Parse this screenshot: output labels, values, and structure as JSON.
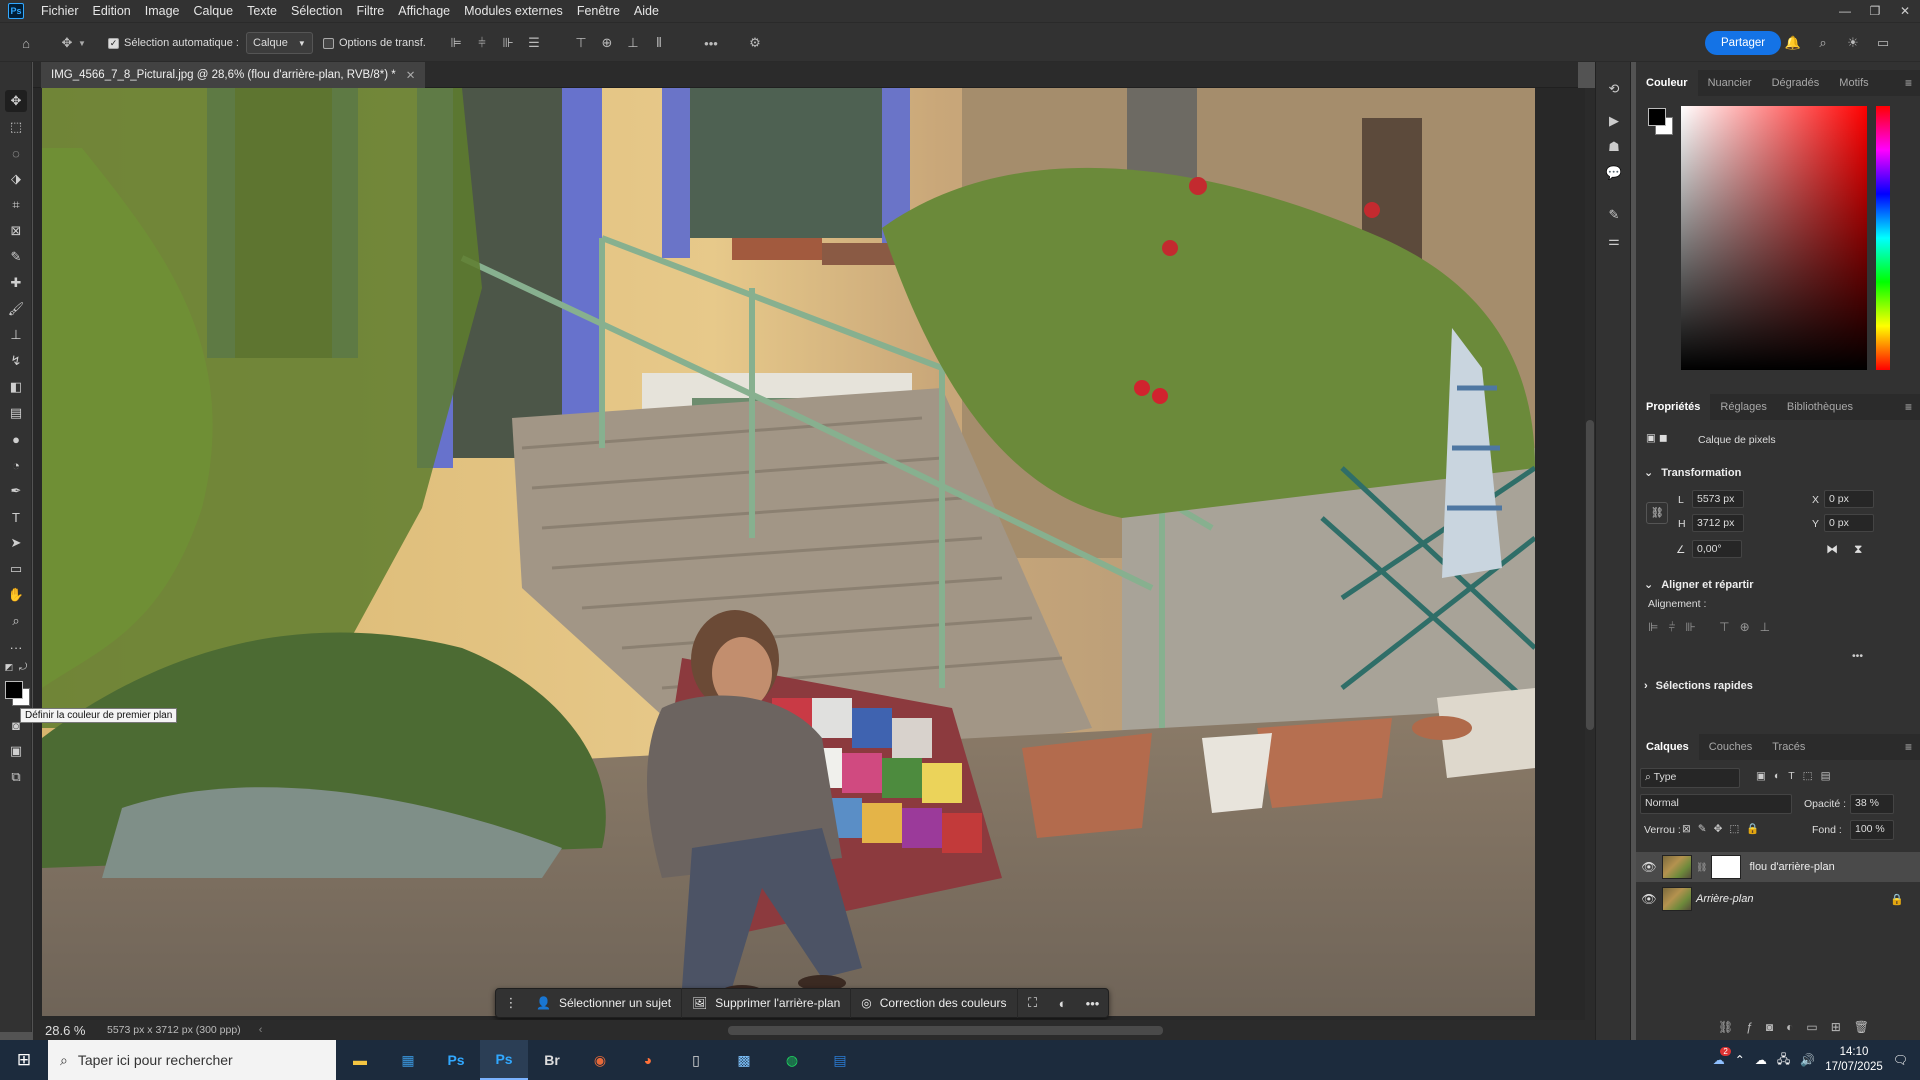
{
  "menubar": {
    "logo": "Ps",
    "items": [
      "Fichier",
      "Edition",
      "Image",
      "Calque",
      "Texte",
      "Sélection",
      "Filtre",
      "Affichage",
      "Modules externes",
      "Fenêtre",
      "Aide"
    ]
  },
  "options": {
    "auto_select_label": "Sélection automatique :",
    "auto_select_checked": true,
    "layer_dropdown": "Calque",
    "transform_label": "Options de transf.",
    "share_label": "Partager"
  },
  "document": {
    "tab_title": "IMG_4566_7_8_Pictural.jpg @ 28,6% (flou d'arrière-plan, RVB/8*) *",
    "zoom": "28.6 %",
    "info": "5573 px x 3712 px (300 ppp)"
  },
  "tooltip": "Définir la couleur de premier plan",
  "context_bar": {
    "select_subject": "Sélectionner un sujet",
    "remove_bg": "Supprimer l'arrière-plan",
    "color_correction": "Correction des couleurs"
  },
  "color_panel": {
    "tabs": [
      "Couleur",
      "Nuancier",
      "Dégradés",
      "Motifs"
    ],
    "foreground": "#000000",
    "background": "#ffffff"
  },
  "properties_panel": {
    "tabs": [
      "Propriétés",
      "Réglages",
      "Bibliothèques"
    ],
    "layer_type": "Calque de pixels",
    "transformation_title": "Transformation",
    "w_label": "L",
    "w_value": "5573 px",
    "h_label": "H",
    "h_value": "3712 px",
    "x_label": "X",
    "x_value": "0 px",
    "y_label": "Y",
    "y_value": "0 px",
    "angle_value": "0,00°",
    "align_title": "Aligner et répartir",
    "alignment_label": "Alignement :",
    "quick_actions_title": "Sélections rapides"
  },
  "layers_panel": {
    "tabs": [
      "Calques",
      "Couches",
      "Tracés"
    ],
    "filter_label": "Type",
    "blend_mode": "Normal",
    "opacity_label": "Opacité :",
    "opacity_value": "38 %",
    "lock_label": "Verrou :",
    "fill_label": "Fond :",
    "fill_value": "100 %",
    "layers": [
      {
        "name": "flou d'arrière-plan",
        "selected": true,
        "has_mask": true
      },
      {
        "name": "Arrière-plan",
        "selected": false,
        "locked": true
      }
    ]
  },
  "taskbar": {
    "search_placeholder": "Taper ici pour rechercher",
    "apps": [
      "Explorateur",
      "Store",
      "Ps",
      "Ps",
      "Br",
      "App",
      "Firefox",
      "Fichier",
      "Photos",
      "Spotify",
      "Word"
    ],
    "time": "14:10",
    "date": "17/07/2025",
    "weather_badge": "2"
  }
}
